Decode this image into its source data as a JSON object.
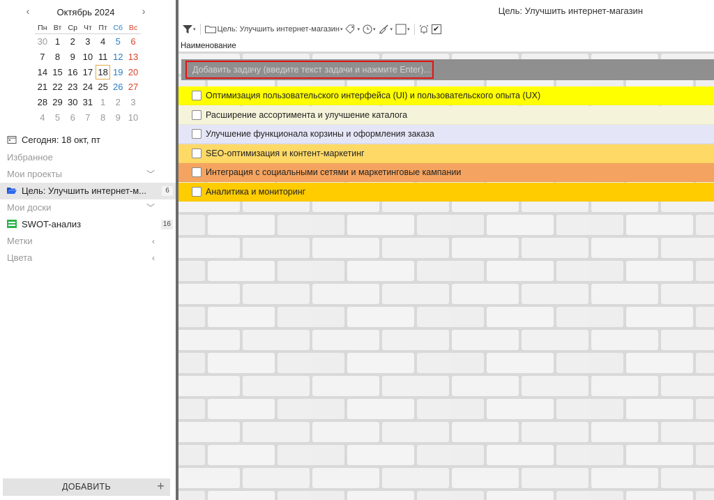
{
  "calendar": {
    "month_label": "Октябрь 2024",
    "prev": "‹",
    "next": "›",
    "weekdays": [
      "Пн",
      "Вт",
      "Ср",
      "Чт",
      "Пт",
      "Сб",
      "Вс"
    ],
    "weeks": [
      [
        "30",
        "1",
        "2",
        "3",
        "4",
        "5",
        "6"
      ],
      [
        "7",
        "8",
        "9",
        "10",
        "11",
        "12",
        "13"
      ],
      [
        "14",
        "15",
        "16",
        "17",
        "18",
        "19",
        "20"
      ],
      [
        "21",
        "22",
        "23",
        "24",
        "25",
        "26",
        "27"
      ],
      [
        "28",
        "29",
        "30",
        "31",
        "1",
        "2",
        "3"
      ],
      [
        "4",
        "5",
        "6",
        "7",
        "8",
        "9",
        "10"
      ]
    ],
    "today": "18"
  },
  "sidebar": {
    "today_label": "Сегодня: 18 окт, пт",
    "favorites": "Избранное",
    "my_projects": "Мои проекты",
    "project_item": "Цель: Улучшить интернет-м...",
    "project_count": "6",
    "my_boards": "Мои доски",
    "board_item": "SWOT-анализ",
    "board_count": "16",
    "tags": "Метки",
    "colors": "Цвета",
    "add_button": "ДОБАВИТЬ",
    "add_plus": "+"
  },
  "main": {
    "title": "Цель: Улучшить интернет-магазин",
    "toolbar_project": "Цель: Улучшить интернет-магазин",
    "toolbar_check": "✔",
    "column_header": "Наименование",
    "add_task_placeholder": "Добавить задачу (введите текст задачи и нажмите Enter)...",
    "tasks": [
      {
        "label": "Оптимизация пользовательского интерфейса (UI) и пользовательского опыта (UX)",
        "color": "#ffff00"
      },
      {
        "label": "Расширение ассортимента и улучшение каталога",
        "color": "#f5f3d9"
      },
      {
        "label": "Улучшение функционала корзины и оформления заказа",
        "color": "#e4e6f7"
      },
      {
        "label": "SEO-оптимизация и контент-маркетинг",
        "color": "#ffd966"
      },
      {
        "label": "Интеграция с социальными сетями и маркетинговые кампании",
        "color": "#f4a460"
      },
      {
        "label": "Аналитика и мониторинг",
        "color": "#ffcc00"
      }
    ]
  }
}
